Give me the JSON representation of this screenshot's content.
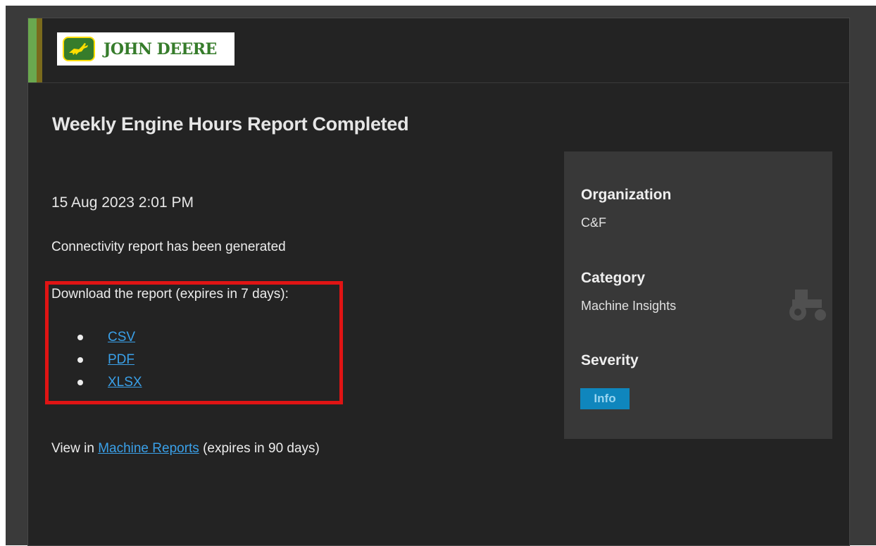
{
  "brand": {
    "logo_text": "JOHN DEERE"
  },
  "notification": {
    "title": "Weekly Engine Hours Report Completed",
    "timestamp": "15 Aug 2023 2:01 PM",
    "body": "Connectivity report has been generated",
    "download_label": "Download the report (expires in 7 days):",
    "downloads": [
      {
        "label": "CSV"
      },
      {
        "label": "PDF"
      },
      {
        "label": "XLSX"
      }
    ],
    "view_prefix": "View in",
    "view_link": "Machine Reports",
    "view_suffix": "(expires in 90 days)"
  },
  "details": {
    "organization_heading": "Organization",
    "organization_value": "C&F",
    "category_heading": "Category",
    "category_value": "Machine Insights",
    "severity_heading": "Severity",
    "severity_badge": "Info"
  },
  "colors": {
    "background": "#232323",
    "panel": "#383838",
    "link": "#3aa0e8",
    "highlight_box": "#e01414",
    "info_badge": "#0f86bd",
    "brand_green": "#367c2b",
    "brand_yellow": "#ffde00"
  },
  "icons": {
    "logo_mark": "deer-icon",
    "watermark": "tractor-icon",
    "list_marker": "bullet-icon"
  }
}
